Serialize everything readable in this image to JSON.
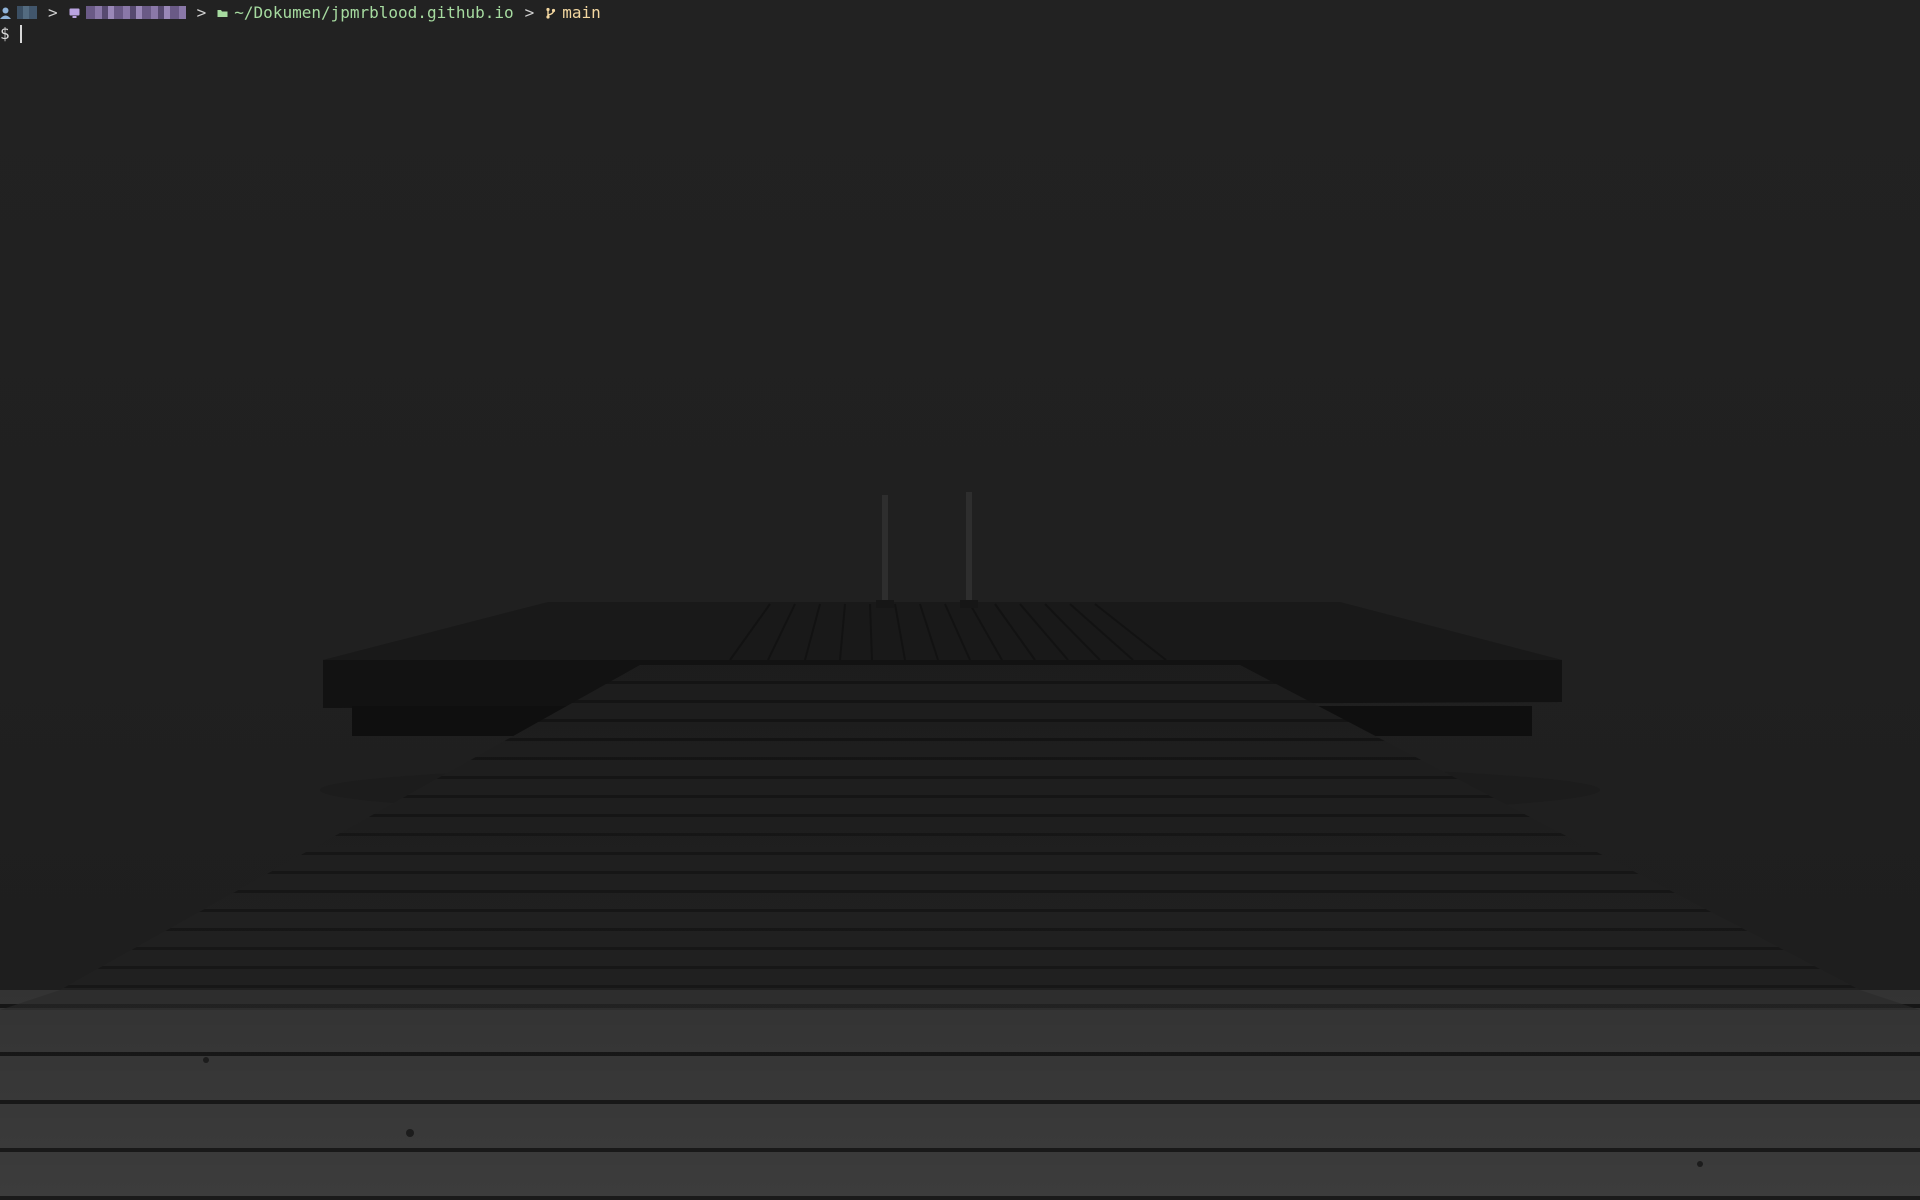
{
  "prompt": {
    "separator": ">",
    "path": "~/Dokumen/jpmrblood.github.io",
    "branch": "main",
    "symbol": "$"
  },
  "icons": {
    "user": "user-icon",
    "host": "monitor-icon",
    "folder": "folder-icon",
    "branch": "git-branch-icon"
  },
  "colors": {
    "background": "#222222",
    "path": "#a6dba0",
    "branch": "#f3d7a0",
    "host": "#8a78a8",
    "text": "#d8d8d8"
  }
}
